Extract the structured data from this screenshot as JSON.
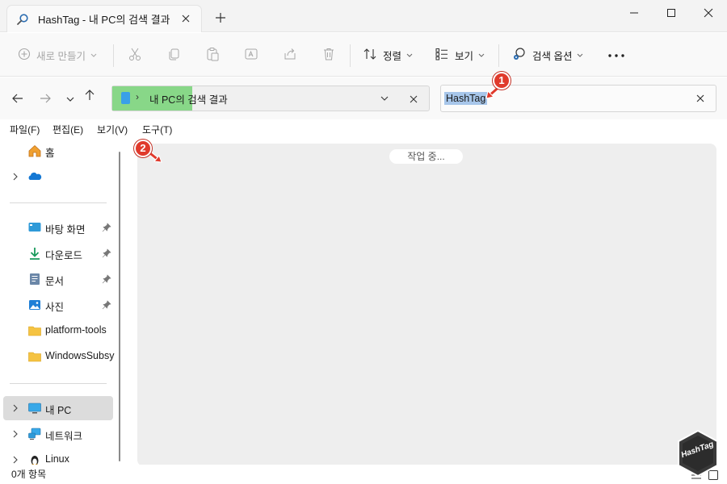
{
  "window": {
    "tab_title": "HashTag - 내 PC의 검색 결과",
    "tab_icon": "search-icon"
  },
  "toolbar": {
    "new_label": "새로 만들기",
    "sort_label": "정렬",
    "view_label": "보기",
    "search_options_label": "검색 옵션"
  },
  "address": {
    "location": "내 PC의 검색 결과",
    "search_value": "HashTag"
  },
  "menu": {
    "file": "파일(F)",
    "edit": "편집(E)",
    "view": "보기(V)",
    "tools": "도구(T)"
  },
  "sidebar": {
    "items": [
      {
        "label": "홈",
        "icon": "home-icon"
      },
      {
        "label": "",
        "icon": "onedrive-cloud-icon"
      },
      {
        "label": "바탕 화면",
        "icon": "desktop-icon"
      },
      {
        "label": "다운로드",
        "icon": "download-icon"
      },
      {
        "label": "문서",
        "icon": "document-icon"
      },
      {
        "label": "사진",
        "icon": "pictures-icon"
      },
      {
        "label": "platform-tools",
        "icon": "folder-icon"
      },
      {
        "label": "WindowsSubsys",
        "icon": "folder-icon"
      },
      {
        "label": "내 PC",
        "icon": "this-pc-icon"
      },
      {
        "label": "네트워크",
        "icon": "network-icon"
      },
      {
        "label": "Linux",
        "icon": "linux-penguin-icon"
      }
    ]
  },
  "content": {
    "status_message": "작업 중..."
  },
  "statusbar": {
    "item_count": "0개 항목"
  },
  "annotations": {
    "badge1": "1",
    "badge2": "2"
  },
  "watermark": {
    "text": "HashTag"
  },
  "colors": {
    "accent_highlight": "#88d788",
    "search_selection": "#a7c6ea",
    "badge": "#e03a2c"
  }
}
